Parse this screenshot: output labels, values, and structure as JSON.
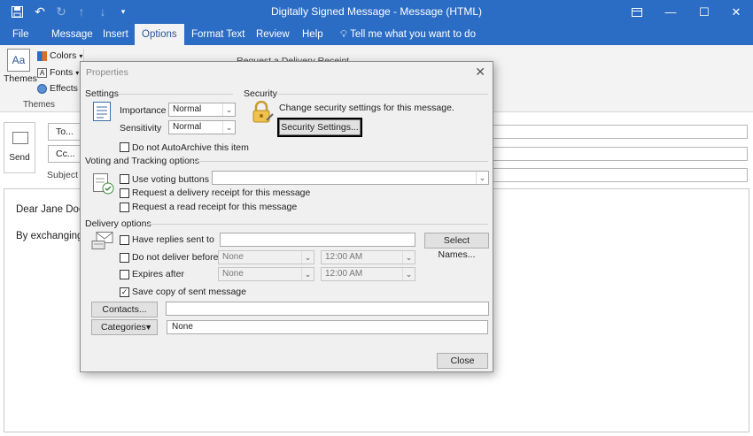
{
  "window": {
    "title": "Digitally Signed Message  -  Message (HTML)",
    "quick_access_icons": [
      "save-icon",
      "undo-icon",
      "redo-icon",
      "up-arrow-icon",
      "down-arrow-icon",
      "customize-icon"
    ],
    "controls": [
      "ribbon-display-icon",
      "minimize-icon",
      "maximize-icon",
      "close-icon"
    ]
  },
  "ribbon": {
    "tabs": [
      "File",
      "Message",
      "Insert",
      "Options",
      "Format Text",
      "Review",
      "Help"
    ],
    "active_tab": "Options",
    "tell_me": "Tell me what you want to do",
    "themes_label": "Themes",
    "colors_label": "Colors",
    "fonts_label": "Fonts",
    "effects_label": "Effects",
    "group_label": "Themes",
    "partial_label": "Request a Delivery Receipt"
  },
  "compose": {
    "send_label": "Send",
    "to_label": "To...",
    "cc_label": "Cc...",
    "subject_label": "Subject",
    "body_line1": "Dear Jane Doe,",
    "body_line2": "By exchanging d"
  },
  "dialog": {
    "title": "Properties",
    "settings": {
      "heading": "Settings",
      "importance_label": "Importance",
      "importance_value": "Normal",
      "sensitivity_label": "Sensitivity",
      "sensitivity_value": "Normal",
      "autoarchive_label": "Do not AutoArchive this item"
    },
    "security": {
      "heading": "Security",
      "description": "Change security settings for this message.",
      "button": "Security Settings..."
    },
    "voting": {
      "heading": "Voting and Tracking options",
      "use_voting_label": "Use voting buttons",
      "delivery_receipt_label": "Request a delivery receipt for this message",
      "read_receipt_label": "Request a read receipt for this message"
    },
    "delivery": {
      "heading": "Delivery options",
      "replies_label": "Have replies sent to",
      "select_names_button": "Select Names...",
      "do_not_deliver_label": "Do not deliver before",
      "do_not_deliver_date": "None",
      "do_not_deliver_time": "12:00 AM",
      "expires_label": "Expires after",
      "expires_date": "None",
      "expires_time": "12:00 AM",
      "save_copy_label": "Save copy of sent message",
      "save_copy_checked": true,
      "contacts_button": "Contacts...",
      "categories_button": "Categories",
      "categories_value": "None"
    },
    "close_button": "Close"
  },
  "colors": {
    "accent": "#2b6cc4",
    "ribbon_bg": "#f3f3f3",
    "dialog_bg": "#f0f0f0"
  }
}
